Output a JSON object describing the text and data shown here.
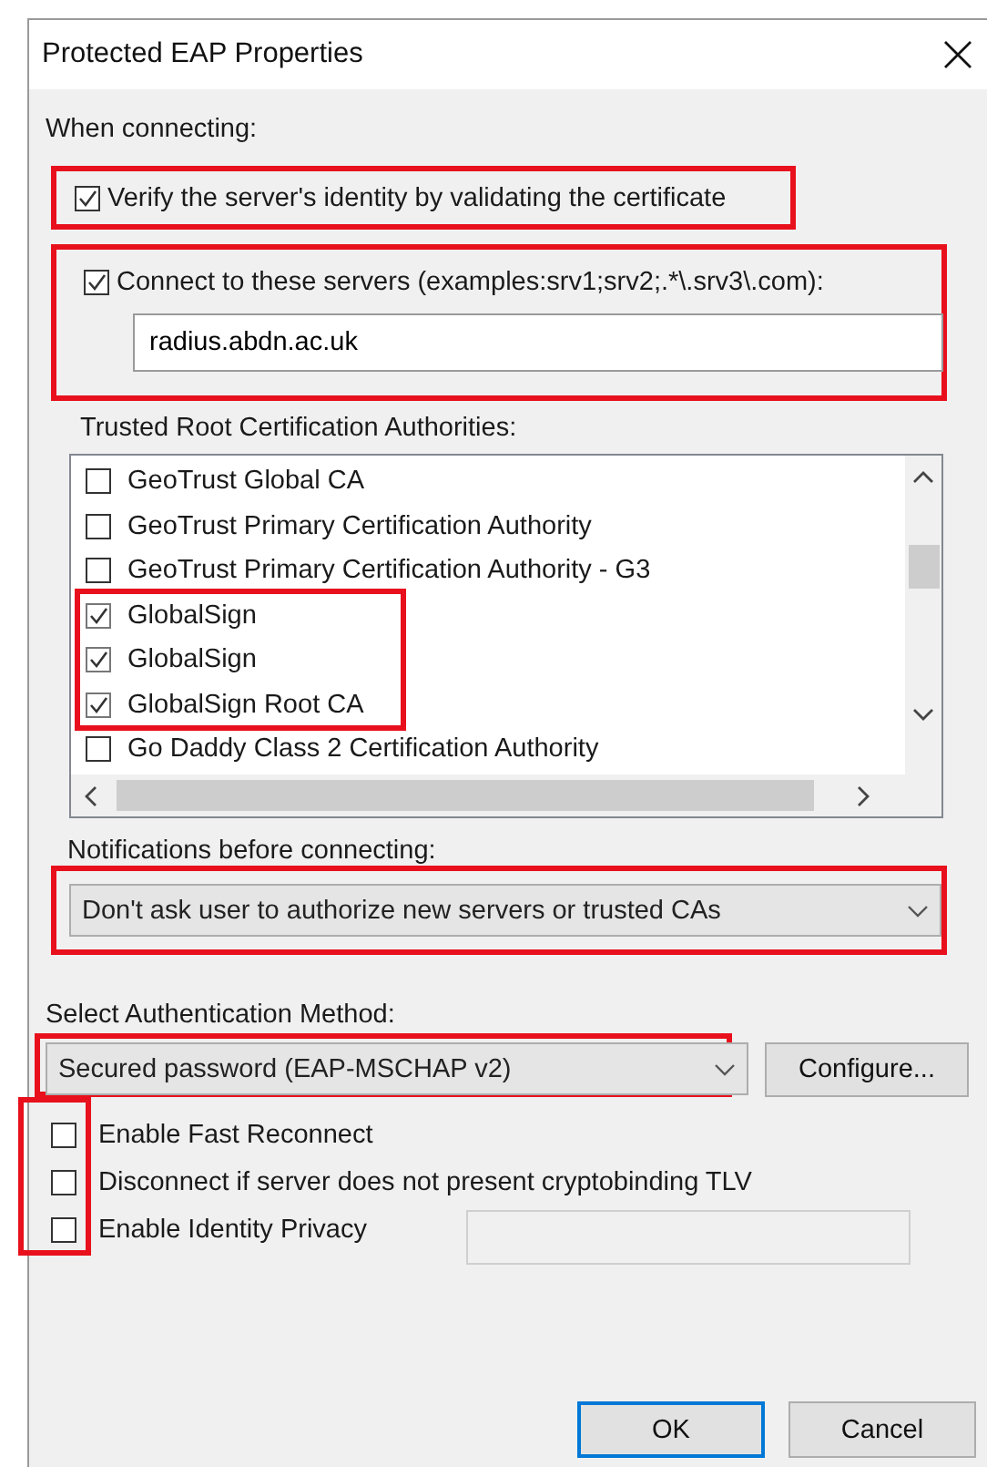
{
  "window": {
    "title": "Protected EAP Properties"
  },
  "when_connecting": {
    "label": "When connecting:",
    "verify_server": {
      "label": "Verify the server's identity by validating the certificate",
      "checked": true,
      "highlighted": true
    },
    "connect_to_servers": {
      "label": "Connect to these servers (examples:srv1;srv2;.*\\.srv3\\.com):",
      "checked": true,
      "highlighted": true,
      "value": "radius.abdn.ac.uk"
    }
  },
  "trusted_roots": {
    "label": "Trusted Root Certification Authorities:",
    "items": [
      {
        "label": "GeoTrust Global CA",
        "checked": false,
        "highlighted": false
      },
      {
        "label": "GeoTrust Primary Certification Authority",
        "checked": false,
        "highlighted": false
      },
      {
        "label": "GeoTrust Primary Certification Authority - G3",
        "checked": false,
        "highlighted": false
      },
      {
        "label": "GlobalSign",
        "checked": true,
        "highlighted": true
      },
      {
        "label": "GlobalSign",
        "checked": true,
        "highlighted": true
      },
      {
        "label": "GlobalSign Root CA",
        "checked": true,
        "highlighted": true
      },
      {
        "label": "Go Daddy Class 2 Certification Authority",
        "checked": false,
        "highlighted": false
      }
    ]
  },
  "notifications": {
    "label": "Notifications before connecting:",
    "value": "Don't ask user to authorize new servers or trusted CAs",
    "highlighted": true
  },
  "authentication": {
    "label": "Select Authentication Method:",
    "value": "Secured password (EAP-MSCHAP v2)",
    "highlighted": true,
    "configure_button": "Configure..."
  },
  "options": {
    "checkboxes_highlighted": true,
    "items": [
      {
        "label": "Enable Fast Reconnect",
        "checked": false
      },
      {
        "label": "Disconnect if server does not present cryptobinding TLV",
        "checked": false
      },
      {
        "label": "Enable Identity Privacy",
        "checked": false
      }
    ],
    "identity_field": {
      "disabled": true
    }
  },
  "buttons": [
    {
      "label": "OK",
      "default": true
    },
    {
      "label": "Cancel",
      "default": false
    }
  ]
}
